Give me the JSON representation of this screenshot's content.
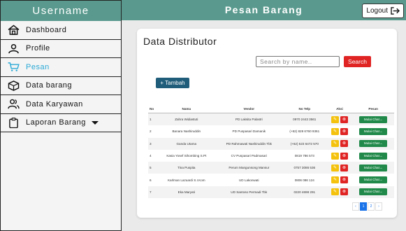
{
  "sidebar": {
    "username": "Username",
    "items": [
      {
        "label": "Dashboard",
        "icon": "home-icon"
      },
      {
        "label": "Profile",
        "icon": "user-icon"
      },
      {
        "label": "Pesan",
        "icon": "cart-icon",
        "active": true
      },
      {
        "label": "Data barang",
        "icon": "box-icon"
      },
      {
        "label": "Data Karyawan",
        "icon": "users-icon"
      },
      {
        "label": "Laporan Barang",
        "icon": "clipboard-icon",
        "has_dropdown": true
      }
    ]
  },
  "header": {
    "title": "Pesan Barang",
    "logout_label": "Logout"
  },
  "main": {
    "title": "Data Distributor",
    "search": {
      "placeholder": "Search by name..",
      "button_label": "Search"
    },
    "add_button_label": "+ Tambah",
    "table": {
      "headers": [
        "No",
        "Nama",
        "Vendor",
        "No Telp",
        "Aksi",
        "Pesan"
      ],
      "rows": [
        {
          "no": "1",
          "nama": "Zahra Widiastuti",
          "vendor": "PD Laksita Palastri",
          "telp": "0970 2443 3561",
          "pesan": "Mulai Chat"
        },
        {
          "no": "2",
          "nama": "Banara Nashiruddin",
          "vendor": "PD Puspasari Damanik",
          "telp": "(+62) 828 6760 9361",
          "pesan": "Mulai Chat"
        },
        {
          "no": "3",
          "nama": "Ganda Utama",
          "vendor": "PD Rahmawati Nashiruddin Tbk",
          "telp": "(+62) 523 6472 570",
          "pesan": "Mulai Chat"
        },
        {
          "no": "4",
          "nama": "Kasia Yosef Sihombing S.Pt",
          "vendor": "CV Puspasari Padmasari",
          "telp": "0819 786 573",
          "pesan": "Mulai Chat"
        },
        {
          "no": "5",
          "nama": "Tina Puspita",
          "vendor": "Perum Mangunsong Mansur",
          "telp": "0757 3086 536",
          "pesan": "Mulai Chat"
        },
        {
          "no": "6",
          "nama": "Karlman Lazuardi S.I.Kom",
          "vendor": "UD Lakonwati",
          "telp": "0806 086 124",
          "pesan": "Mulai Chat"
        },
        {
          "no": "7",
          "nama": "Eka Maryati",
          "vendor": "UD Santoso Permadi Tbk",
          "telp": "0220 4698 291",
          "pesan": "Mulai Chat"
        }
      ]
    },
    "pagination": {
      "prev": "‹",
      "current": "1",
      "next_page": "2",
      "next": "›"
    }
  },
  "colors": {
    "header": "#5a9a8e",
    "active": "#2aa9d6",
    "add_button": "#1f5d7a",
    "search_button": "#e02424",
    "chat_button": "#218a4a",
    "edit_button": "#f4c20d"
  }
}
